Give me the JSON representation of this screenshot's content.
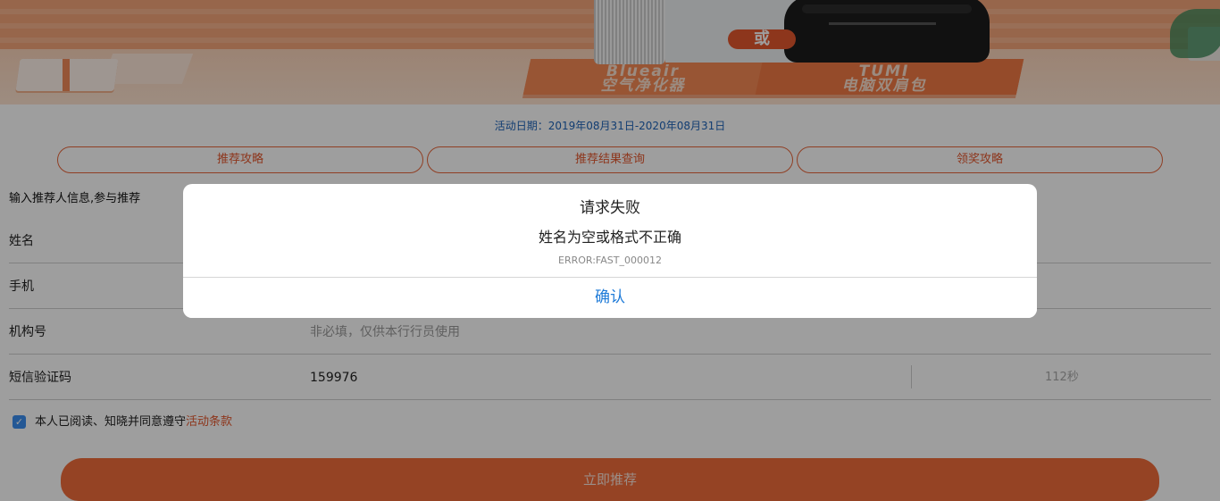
{
  "banner": {
    "title": "",
    "product_left_en": "Blueair",
    "product_left_cn": "空气净化器",
    "product_right_en": "TUMI",
    "product_right_cn": "电脑双肩包",
    "or_badge": "或"
  },
  "activity_date": "活动日期：2019年08月31日-2020年08月31日",
  "tabs": [
    {
      "label": "推荐攻略"
    },
    {
      "label": "推荐结果查询"
    },
    {
      "label": "领奖攻略"
    }
  ],
  "form": {
    "section_title": "输入推荐人信息,参与推荐",
    "fields": {
      "name": {
        "label": "姓名",
        "value": ""
      },
      "phone": {
        "label": "手机",
        "value": ""
      },
      "org": {
        "label": "机构号",
        "placeholder": "非必填，仅供本行行员使用"
      },
      "sms": {
        "label": "短信验证码",
        "value": "159976",
        "countdown": "112秒"
      }
    },
    "agreement": {
      "text": "本人已阅读、知晓并同意遵守",
      "link": "活动条款",
      "checked": true
    },
    "submit_label": "立即推荐"
  },
  "dialog": {
    "title": "请求失败",
    "message": "姓名为空或格式不正确",
    "error_code": "ERROR:FAST_000012",
    "confirm_label": "确认"
  },
  "colors": {
    "accent": "#e4572e",
    "link_blue": "#1f7bd8",
    "checkbox_blue": "#3b8ef0"
  }
}
